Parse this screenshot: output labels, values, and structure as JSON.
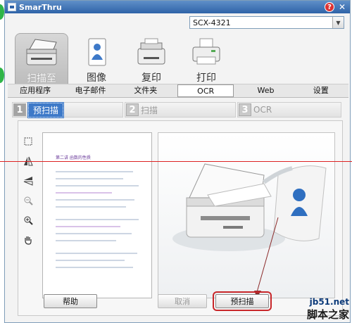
{
  "window": {
    "title": "SmarThru"
  },
  "device": {
    "selected": "SCX-4321"
  },
  "modes": [
    {
      "label": "扫描至",
      "icon": "scanner-icon",
      "active": true
    },
    {
      "label": "图像",
      "icon": "image-person-icon",
      "active": false
    },
    {
      "label": "复印",
      "icon": "copier-icon",
      "active": false
    },
    {
      "label": "打印",
      "icon": "printer-icon",
      "active": false
    }
  ],
  "subtabs": [
    {
      "label": "应用程序",
      "active": false
    },
    {
      "label": "电子邮件",
      "active": false
    },
    {
      "label": "文件夹",
      "active": false
    },
    {
      "label": "OCR",
      "active": true
    },
    {
      "label": "Web",
      "active": false
    },
    {
      "label": "设置",
      "active": false
    }
  ],
  "steps": [
    {
      "number": "1",
      "label": "预扫描",
      "active": true
    },
    {
      "number": "2",
      "label": "扫描",
      "active": false
    },
    {
      "number": "3",
      "label": "OCR",
      "active": false
    }
  ],
  "tools": [
    "select-area-icon",
    "flip-horizontal-icon",
    "flip-vertical-icon",
    "zoom-out-icon",
    "zoom-in-icon",
    "hand-pan-icon"
  ],
  "preview_doc": {
    "heading": "第二讲 函数的性质"
  },
  "buttons": {
    "help": "帮助",
    "cancel": "取消",
    "prescan": "预扫描"
  },
  "watermark": {
    "url": "jb51.net",
    "site": "脚本之家"
  },
  "colors": {
    "title_bar": "#2f63a8",
    "step_active": "#3d79c8",
    "annotation_red": "#c8272a"
  }
}
